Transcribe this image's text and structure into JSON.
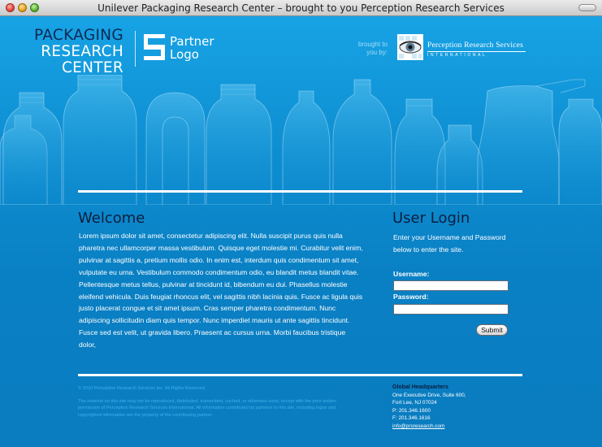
{
  "window": {
    "title": "Unilever Packaging Research Center – brought to you Perception Research Services"
  },
  "header": {
    "prc_logo": [
      "PACKAGING",
      "RESEARCH",
      "CENTER"
    ],
    "partner_logo": [
      "Partner",
      "Logo"
    ],
    "brought_to_you_by": [
      "brought to",
      "you by:"
    ],
    "prs_name": "Perception Research Services",
    "prs_sub": "INTERNATIONAL"
  },
  "welcome": {
    "title": "Welcome",
    "body": "Lorem ipsum dolor sit amet, consectetur adipiscing elit. Nulla suscipit purus quis nulla pharetra nec ullamcorper massa vestibulum. Quisque eget molestie mi. Curabitur velit enim, pulvinar at sagittis a, pretium mollis odio. In enim est, interdum quis condimentum sit amet, vulputate eu urna. Vestibulum commodo condimentum odio, eu blandit metus blandit vitae. Pellentesque metus tellus, pulvinar at tincidunt id, bibendum eu dui. Phasellus molestie eleifend vehicula. Duis feugiat rhoncus elit, vel sagittis nibh lacinia quis. Fusce ac ligula quis justo placerat congue et sit amet ipsum. Cras semper pharetra condimentum. Nunc adipiscing sollicitudin diam quis tempor. Nunc imperdiet mauris ut ante sagittis tincidunt. Fusce sed est velit, ut gravida libero. Praesent ac cursus urna. Morbi faucibus tristique dolor,"
  },
  "login": {
    "title": "User Login",
    "instructions": "Enter your Username and Password below to enter the site.",
    "username_label": "Username:",
    "password_label": "Password:",
    "username_value": "",
    "password_value": "",
    "submit_label": "Submit"
  },
  "footer": {
    "copyright": "© 2010 Perception Research Services Inc. All Rights Reserved",
    "disclaimer": "The material on this site may not be reproduced, distributed, transmitted, cached, or otherwise used, except with the prior written permission of Perception Research Services International. All information contributed by partners to this site, including logos and copyrighted information are the property of the contributing partner.",
    "hq": {
      "title": "Global Headquarters",
      "address1": "One Executive Drive, Suite 600,",
      "address2": "Fort Lee, NJ 07024",
      "phone": "P: 201.346.1600",
      "fax": "F: 201.346.1616",
      "email": "info@prsresearch.com"
    }
  },
  "colors": {
    "page_top": "#17a3e5",
    "page_bottom": "#0a7cc0",
    "heading_dark": "#0a1e3f",
    "footer_text": "#3bb2ea"
  }
}
